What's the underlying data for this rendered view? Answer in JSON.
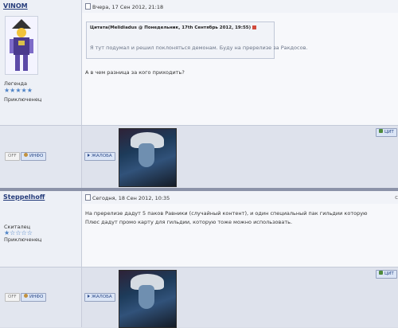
{
  "posts": [
    {
      "username": "VINOM",
      "rank": "Легенда",
      "stars": "★★★★★",
      "group": "Приключенец",
      "date": "Вчера, 17 Сен 2012, 21:18",
      "quote": {
        "title": "Цитата(Melidiadus @ Понедельник, 17th Сентябрь 2012, 19:55)",
        "text": "Я тут подумал и решил поклоняться демонам. Буду на пререлизе за Ракдосов."
      },
      "text_lines": [
        "А в чем разница за кого приходить?"
      ],
      "buttons": {
        "off": "OFF",
        "info": "ИНФО",
        "report": "ЖАЛОБА",
        "quote": "ЦИТ"
      }
    },
    {
      "username": "Steppelhoff",
      "rank": "Скиталец",
      "stars": "★☆☆☆☆",
      "group": "Приключенец",
      "date": "Сегодня, 18 Сен 2012, 10:35",
      "text_lines": [
        "На пререлизе дадут 5 паков Равники (случайный контент), и один специальный пак гильдии которую",
        "Плюс дадут промо карту для гильдии, которую тоже можно использовать."
      ],
      "buttons": {
        "off": "OFF",
        "info": "ИНФО",
        "report": "ЖАЛОБА",
        "quote": "ЦИТ"
      }
    }
  ],
  "colors": {
    "link": "#243b7a",
    "star": "#4f83c6",
    "accent_button": "#dbe5f6"
  }
}
